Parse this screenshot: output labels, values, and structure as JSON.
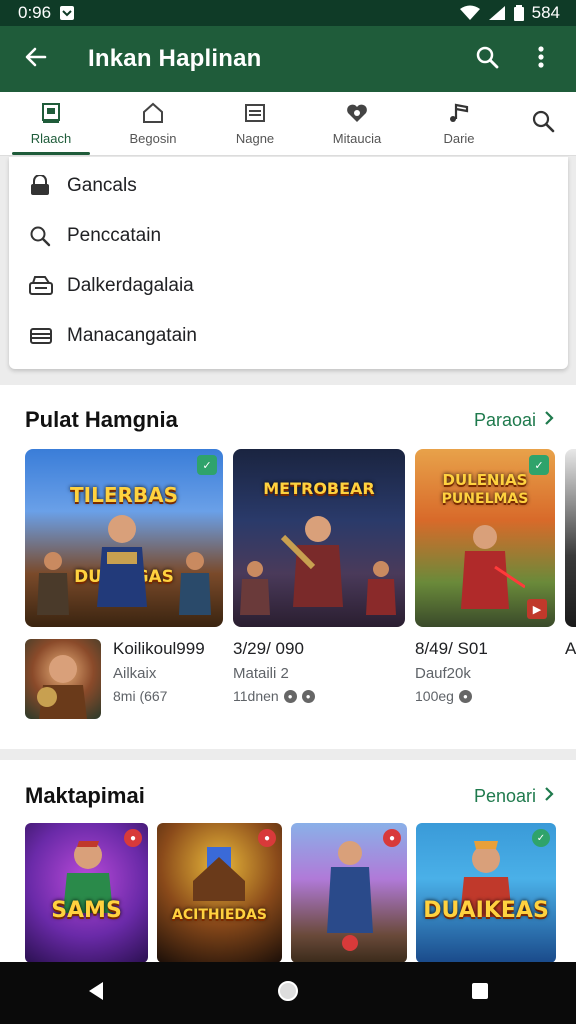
{
  "status_bar": {
    "time": "0:96",
    "battery": "584"
  },
  "app_bar": {
    "title": "Inkan Haplinan",
    "icons": [
      "back-arrow-icon",
      "search-icon",
      "more-vert-icon"
    ]
  },
  "tabs": [
    {
      "label": "Rlaach",
      "icon": "home-icon"
    },
    {
      "label": "Begosin",
      "icon": "store-icon"
    },
    {
      "label": "Nagne",
      "icon": "list-icon"
    },
    {
      "label": "Mitaucia",
      "icon": "heart-icon"
    },
    {
      "label": "Darie",
      "icon": "music-icon"
    }
  ],
  "menu": [
    {
      "label": "Gancals",
      "icon": "lock-icon"
    },
    {
      "label": "Penccatain",
      "icon": "search-icon"
    },
    {
      "label": "Dalkerdagalaia",
      "icon": "printer-icon"
    },
    {
      "label": "Manacangatain",
      "icon": "card-icon"
    }
  ],
  "section1": {
    "title": "Pulat Hamgnia",
    "more": "Paraoai",
    "cards": [
      {
        "art_title": "TILERBAS",
        "art_sub": "DURIKGAS"
      },
      {
        "art_title": "METROBEAR",
        "art_sub": "",
        "price": "3/29/ 090",
        "sub": "Mataili 2",
        "meta": "11dnen"
      },
      {
        "art_title": "DULENIAS",
        "art_sub": "PUNELMAS",
        "price": "8/49/ S01",
        "sub": "Dauf20k",
        "meta": "100eg"
      },
      {
        "price": "A"
      }
    ],
    "first_item": {
      "name": "Koilikoul999",
      "sub": "Ailkaix",
      "meta": "8mi (667"
    }
  },
  "section2": {
    "title": "Maktapimai",
    "more": "Penoari",
    "tiles": [
      {
        "label": "SAMS"
      },
      {
        "label": "ACITHIEDAS"
      },
      {
        "label": ""
      },
      {
        "label": "DUAIKEAS"
      }
    ]
  },
  "colors": {
    "app_bar": "#1f5c3a",
    "accent": "#1f7a4d",
    "status_bar": "#0f3b27"
  }
}
